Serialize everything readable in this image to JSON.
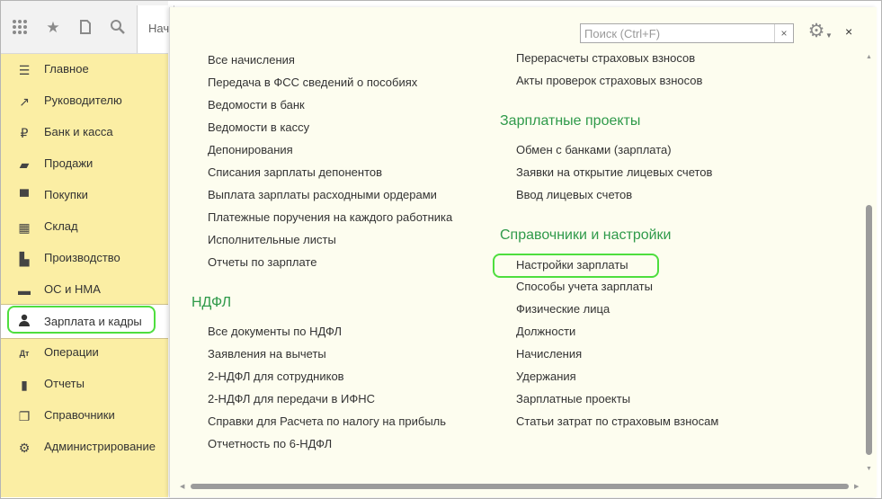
{
  "toolbar": {
    "icons": [
      "apps-grid-icon",
      "star-icon",
      "history-icon",
      "search-icon"
    ],
    "tab_label": "Нача"
  },
  "sidebar": {
    "items": [
      {
        "label": "Главное",
        "icon": "menu-icon",
        "glyph": "☰"
      },
      {
        "label": "Руководителю",
        "icon": "trend-icon",
        "glyph": "↗"
      },
      {
        "label": "Банк и касса",
        "icon": "ruble-icon",
        "glyph": "₽"
      },
      {
        "label": "Продажи",
        "icon": "bag-icon",
        "glyph": "▰"
      },
      {
        "label": "Покупки",
        "icon": "cart-icon",
        "glyph": "▀"
      },
      {
        "label": "Склад",
        "icon": "warehouse-icon",
        "glyph": "▦"
      },
      {
        "label": "Производство",
        "icon": "factory-icon",
        "glyph": "▙"
      },
      {
        "label": "ОС и НМА",
        "icon": "truck-icon",
        "glyph": "▬"
      },
      {
        "label": "Зарплата и кадры",
        "icon": "person-icon",
        "glyph": "●"
      },
      {
        "label": "Операции",
        "icon": "debit-credit-icon",
        "glyph": "Дт"
      },
      {
        "label": "Отчеты",
        "icon": "bar-chart-icon",
        "glyph": "▮"
      },
      {
        "label": "Справочники",
        "icon": "books-icon",
        "glyph": "❐"
      },
      {
        "label": "Администрирование",
        "icon": "gear-icon",
        "glyph": "⚙"
      }
    ]
  },
  "panel": {
    "search_placeholder": "Поиск (Ctrl+F)",
    "search_clear": "×",
    "close": "×",
    "left_col_top": [
      "Все начисления",
      "Передача в ФСС сведений о пособиях",
      "Ведомости в банк",
      "Ведомости в кассу",
      "Депонирования",
      "Списания зарплаты депонентов",
      "Выплата зарплаты расходными ордерами",
      "Платежные поручения на каждого работника",
      "Исполнительные листы",
      "Отчеты по зарплате"
    ],
    "ndfl_title": "НДФЛ",
    "ndfl_items": [
      "Все документы по НДФЛ",
      "Заявления на вычеты",
      "2-НДФЛ для сотрудников",
      "2-НДФЛ для передачи в ИФНС",
      "Справки для Расчета по налогу на прибыль",
      "Отчетность по 6-НДФЛ"
    ],
    "right_col_top": [
      "Перерасчеты страховых взносов",
      "Акты проверок страховых взносов"
    ],
    "salary_projects_title": "Зарплатные проекты",
    "salary_projects_items": [
      "Обмен с банками (зарплата)",
      "Заявки на открытие лицевых счетов",
      "Ввод лицевых счетов"
    ],
    "settings_title": "Справочники и настройки",
    "settings_items": [
      "Настройки зарплаты",
      "Способы учета зарплаты",
      "Физические лица",
      "Должности",
      "Начисления",
      "Удержания",
      "Зарплатные проекты",
      "Статьи затрат по страховым взносам"
    ]
  },
  "colors": {
    "sidebar_bg": "#fbeea4",
    "panel_bg": "#fdfdef",
    "section_title": "#2f9a4a",
    "highlight": "#4ede3e"
  }
}
